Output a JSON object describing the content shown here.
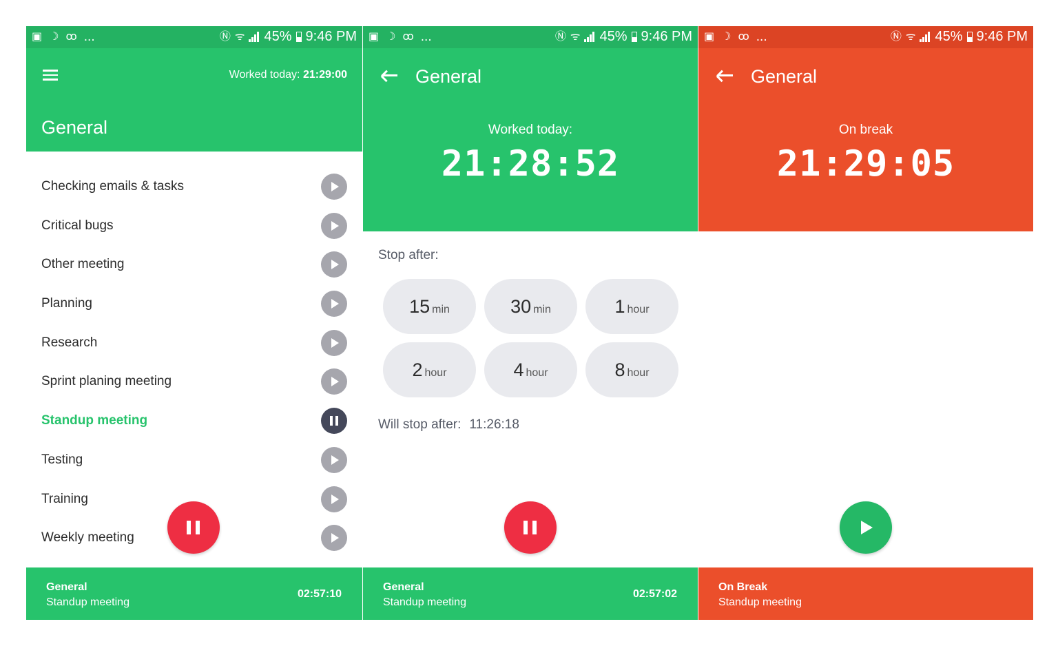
{
  "status": {
    "battery": "45%",
    "time": "9:46 PM",
    "dots": "..."
  },
  "screen1": {
    "worked_label": "Worked today:",
    "worked_value": "21:29:00",
    "title": "General",
    "tasks": [
      {
        "label": "Checking emails & tasks",
        "active": false
      },
      {
        "label": "Critical bugs",
        "active": false
      },
      {
        "label": "Other meeting",
        "active": false
      },
      {
        "label": "Planning",
        "active": false
      },
      {
        "label": "Research",
        "active": false
      },
      {
        "label": "Sprint planing meeting",
        "active": false
      },
      {
        "label": "Standup meeting",
        "active": true
      },
      {
        "label": "Testing",
        "active": false
      },
      {
        "label": "Training",
        "active": false
      },
      {
        "label": "Weekly meeting",
        "active": false
      }
    ],
    "bottom": {
      "project": "General",
      "task": "Standup meeting",
      "time": "02:57:10"
    }
  },
  "screen2": {
    "title": "General",
    "subtitle": "Worked today:",
    "timer": "21:28:52",
    "stop_after_label": "Stop after:",
    "chips": [
      {
        "n": "15",
        "u": "min"
      },
      {
        "n": "30",
        "u": "min"
      },
      {
        "n": "1",
        "u": "hour"
      },
      {
        "n": "2",
        "u": "hour"
      },
      {
        "n": "4",
        "u": "hour"
      },
      {
        "n": "8",
        "u": "hour"
      }
    ],
    "will_stop_label": "Will stop after:",
    "will_stop_value": "11:26:18",
    "bottom": {
      "project": "General",
      "task": "Standup meeting",
      "time": "02:57:02"
    }
  },
  "screen3": {
    "title": "General",
    "subtitle": "On break",
    "timer": "21:29:05",
    "bottom": {
      "project": "On Break",
      "task": "Standup meeting"
    }
  },
  "colors": {
    "green": "#27c36c",
    "orange": "#eb4f2b",
    "red_fab": "#ee2e43",
    "dark_button": "#44485a"
  }
}
